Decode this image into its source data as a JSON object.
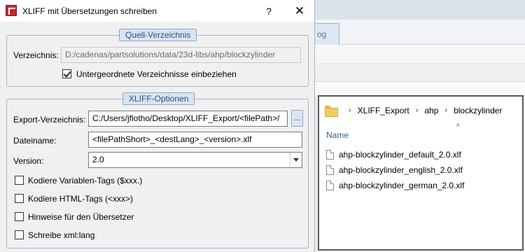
{
  "dialog": {
    "title": "XLIFF mit Übersetzungen schreiben",
    "help_label": "?",
    "close_label": "✕"
  },
  "source_group": {
    "legend": "Quell-Verzeichnis",
    "directory_label": "Verzeichnis:",
    "directory_value": "D:/cadenas/partsolutions/data/23d-libs/ahp/blockzylinder",
    "subdirs_label": "Untergeordnete Verzeichnisse einbeziehen",
    "subdirs_checked": true
  },
  "xliff_group": {
    "legend": "XLIFF-Optionen",
    "export_dir_label": "Export-Verzeichnis:",
    "export_dir_value": "C:/Users/jflotho/Desktop/XLIFF_Export/<filePath>/",
    "browse_label": "...",
    "filename_label": "Dateiname:",
    "filename_value": "<filePathShort>_<destLang>_<version>.xlf",
    "version_label": "Version:",
    "version_value": "2.0",
    "options": [
      {
        "label": "Kodiere Variablen-Tags ($xxx.)",
        "checked": false
      },
      {
        "label": "Kodiere HTML-Tags (<xxx>)",
        "checked": false
      },
      {
        "label": "Hinweise für den Übersetzer",
        "checked": false
      },
      {
        "label": "Schreibe xml:lang",
        "checked": false
      }
    ]
  },
  "background": {
    "tab_label": "og"
  },
  "explorer": {
    "breadcrumb": [
      "XLIFF_Export",
      "ahp",
      "blockzylinder"
    ],
    "column_name": "Name",
    "files": [
      "ahp-blockzylinder_default_2.0.xlf",
      "ahp-blockzylinder_english_2.0.xlf",
      "ahp-blockzylinder_german_2.0.xlf"
    ]
  },
  "colors": {
    "dialog_bg": "#f0f0f0",
    "legend_bg": "#d9e4f2",
    "legend_text": "#2a4f86",
    "app_icon": "#c4262e",
    "explorer_header": "#3a5f8f"
  },
  "icons": [
    "app-icon",
    "help-icon",
    "close-icon",
    "folder-icon",
    "chevron-right-icon",
    "sort-caret-icon",
    "file-icon",
    "dropdown-arrow-icon"
  ]
}
